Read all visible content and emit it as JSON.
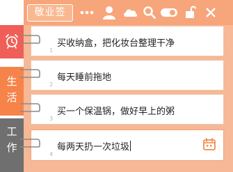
{
  "app": {
    "brand_label": "敬业签"
  },
  "toolbar": {
    "icons": [
      "more-icon",
      "user-icon",
      "cloud-icon",
      "search-icon",
      "toggle-icon",
      "unlock-icon",
      "close-icon"
    ]
  },
  "sidebar": {
    "categories": [
      {
        "label": "",
        "icon": "alarm-clock-icon",
        "color": "#ef5f58"
      },
      {
        "label": "生活",
        "color": "#f6844a"
      },
      {
        "label": "工作",
        "color": "#6f6f6f"
      }
    ]
  },
  "notes": [
    {
      "number": "1",
      "text": "买收纳盒，把化妆台整理干净"
    },
    {
      "number": "2",
      "text": "每天睡前拖地"
    },
    {
      "number": "3",
      "text": "买一个保温锅，做好早上的粥"
    },
    {
      "number": "4",
      "text": "每两天扔一次垃圾"
    }
  ],
  "colors": {
    "accent": "#f7a57b",
    "panel": "#f6b896",
    "calendar_icon": "#f28b4a"
  }
}
